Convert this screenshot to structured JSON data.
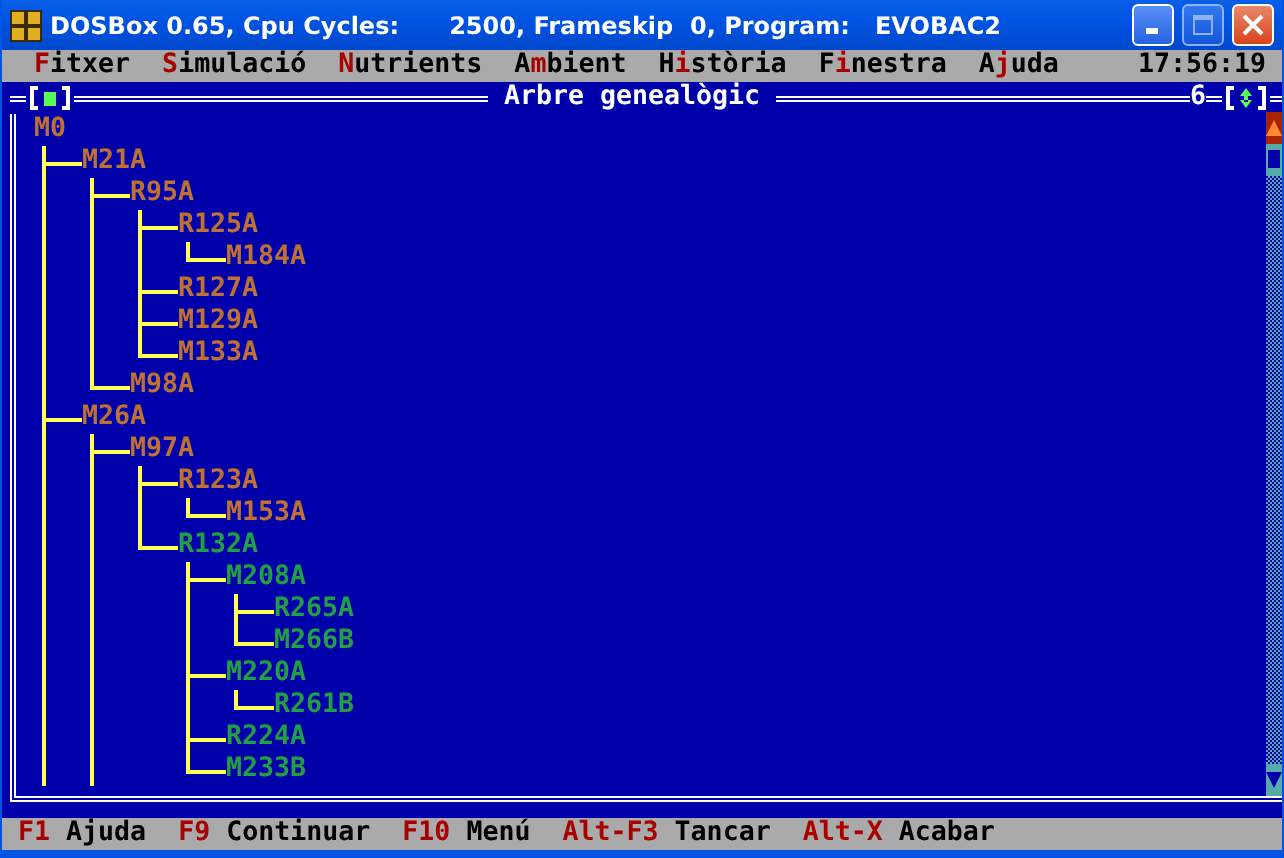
{
  "window": {
    "title": "DOSBox 0.65, Cpu Cycles:      2500, Frameskip  0, Program:   EVOBAC2",
    "maximize_disabled": true
  },
  "menu": [
    {
      "hot": "F",
      "after": "itxer"
    },
    {
      "hot": "S",
      "after": "imulació"
    },
    {
      "hot": "N",
      "after": "utrients"
    },
    {
      "before": "A",
      "hot": "m",
      "after": "bient"
    },
    {
      "before": "H",
      "hot": "i",
      "after": "stòria"
    },
    {
      "before": "F",
      "hot": "i",
      "after": "nestra"
    },
    {
      "before": "A",
      "hot": "j",
      "after": "uda"
    }
  ],
  "clock": "17:56:19",
  "panel": {
    "title": "Arbre genealògic",
    "number": "6"
  },
  "tree": {
    "label": "M0",
    "color": "#c07030",
    "truncated": true,
    "children": [
      {
        "label": "M21A",
        "color": "#c07030",
        "children": [
          {
            "label": "R95A",
            "color": "#c07030",
            "children": [
              {
                "label": "R125A",
                "color": "#c07030",
                "children": [
                  {
                    "label": "M184A",
                    "color": "#c07030"
                  }
                ]
              },
              {
                "label": "R127A",
                "color": "#c07030"
              },
              {
                "label": "M129A",
                "color": "#c07030"
              },
              {
                "label": "M133A",
                "color": "#c07030"
              }
            ]
          },
          {
            "label": "M98A",
            "color": "#c07030"
          }
        ]
      },
      {
        "label": "M26A",
        "color": "#c07030",
        "truncated": true,
        "children": [
          {
            "label": "M97A",
            "color": "#c07030",
            "children": [
              {
                "label": "R123A",
                "color": "#c07030",
                "children": [
                  {
                    "label": "M153A",
                    "color": "#c07030"
                  }
                ]
              },
              {
                "label": "R132A",
                "color": "#20a040",
                "children": [
                  {
                    "label": "M208A",
                    "color": "#20a040",
                    "children": [
                      {
                        "label": "R265A",
                        "color": "#20a040"
                      },
                      {
                        "label": "M266B",
                        "color": "#20a040"
                      }
                    ]
                  },
                  {
                    "label": "M220A",
                    "color": "#20a040",
                    "children": [
                      {
                        "label": "R261B",
                        "color": "#20a040"
                      }
                    ]
                  },
                  {
                    "label": "R224A",
                    "color": "#20a040"
                  },
                  {
                    "label": "M233B",
                    "color": "#20a040"
                  }
                ]
              }
            ]
          }
        ]
      }
    ]
  },
  "status": [
    {
      "key": "F1",
      "label": "Ajuda"
    },
    {
      "key": "F9",
      "label": "Continuar"
    },
    {
      "key": "F10",
      "label": "Menú"
    },
    {
      "key": "Alt-F3",
      "label": "Tancar"
    },
    {
      "key": "Alt-X",
      "label": "Acabar"
    }
  ]
}
